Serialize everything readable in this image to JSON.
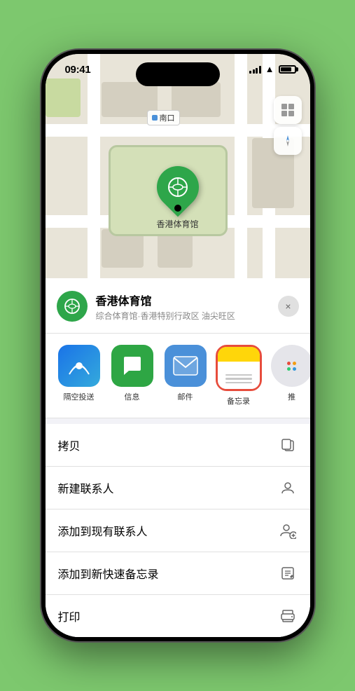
{
  "statusBar": {
    "time": "09:41",
    "locationIcon": "▶"
  },
  "map": {
    "labelText": "南口",
    "pinLabel": "香港体育馆"
  },
  "mapControls": {
    "mapTypeIcon": "⊞",
    "locationIcon": "➤"
  },
  "locationCard": {
    "name": "香港体育馆",
    "address": "综合体育馆·香港特别行政区 油尖旺区",
    "closeLabel": "×"
  },
  "shareItems": [
    {
      "id": "airdrop",
      "label": "隔空投送",
      "type": "airdrop"
    },
    {
      "id": "messages",
      "label": "信息",
      "type": "msg"
    },
    {
      "id": "mail",
      "label": "邮件",
      "type": "mail"
    },
    {
      "id": "notes",
      "label": "备忘录",
      "type": "notes"
    },
    {
      "id": "more",
      "label": "推",
      "type": "more"
    }
  ],
  "actionItems": [
    {
      "label": "拷贝",
      "icon": "copy"
    },
    {
      "label": "新建联系人",
      "icon": "person"
    },
    {
      "label": "添加到现有联系人",
      "icon": "person-add"
    },
    {
      "label": "添加到新快速备忘录",
      "icon": "note"
    },
    {
      "label": "打印",
      "icon": "print"
    }
  ]
}
